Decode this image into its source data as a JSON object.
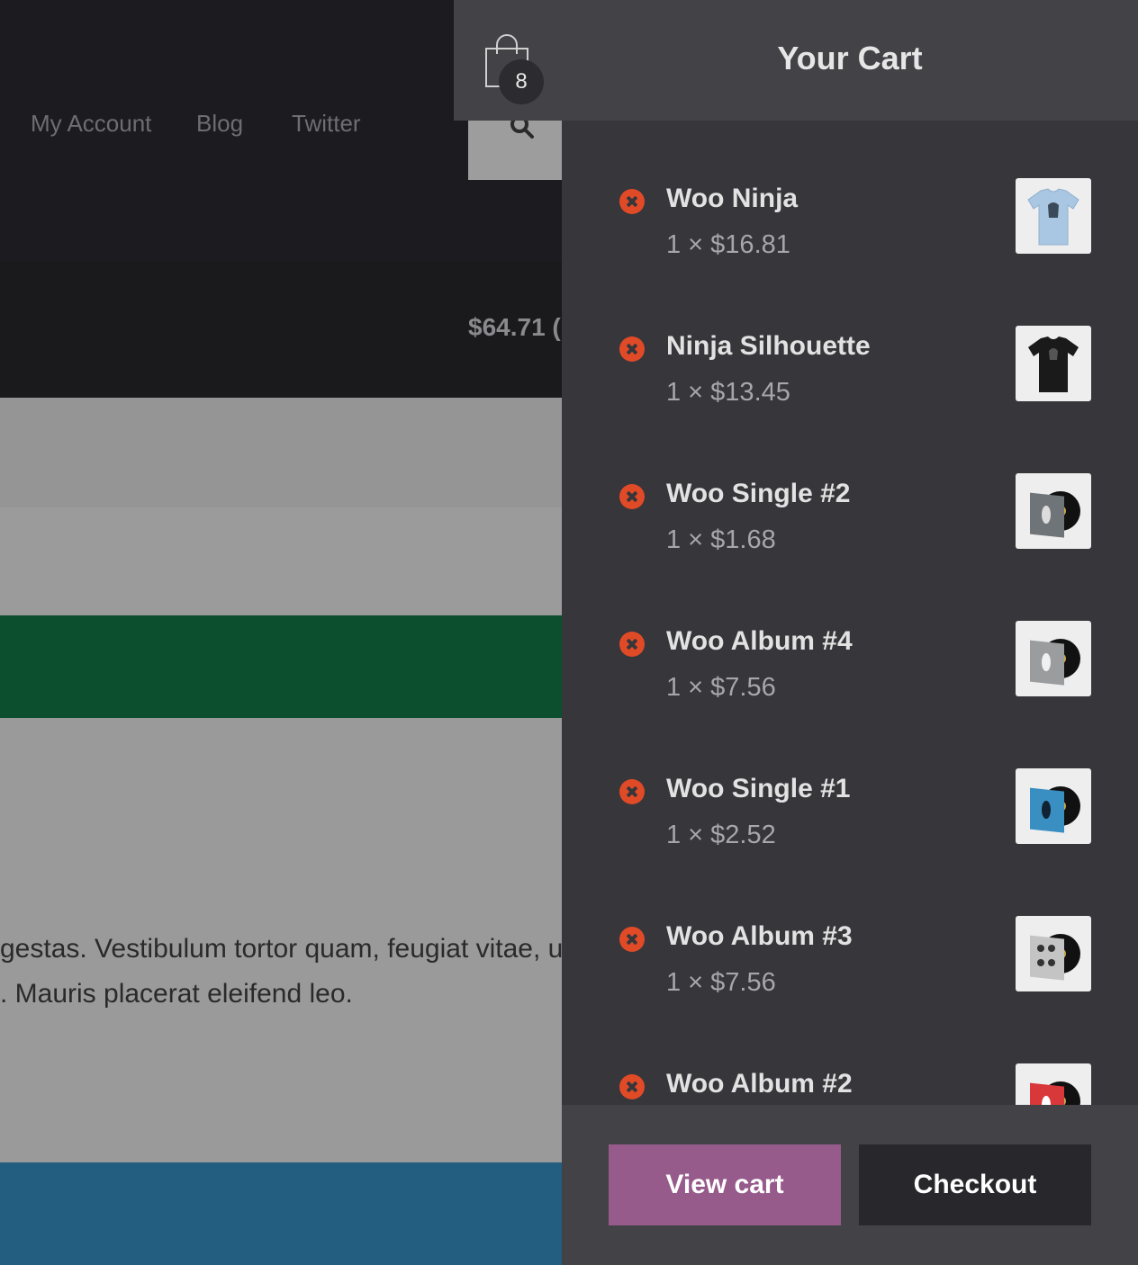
{
  "background_page": {
    "nav": [
      "My Account",
      "Blog",
      "Twitter"
    ],
    "cart_total_partial": "$64.71 (",
    "paragraph_lines": [
      "gestas. Vestibulum tortor quam, feugiat vitae, u",
      ". Mauris placerat eleifend leo."
    ]
  },
  "cart": {
    "title": "Your Cart",
    "count": "8",
    "items": [
      {
        "name": "Woo Ninja",
        "qty_price": "1 × $16.81",
        "thumb": "light-blue-tshirt"
      },
      {
        "name": "Ninja Silhouette",
        "qty_price": "1 × $13.45",
        "thumb": "black-tshirt"
      },
      {
        "name": "Woo Single #2",
        "qty_price": "1 × $1.68",
        "thumb": "vinyl-gray"
      },
      {
        "name": "Woo Album #4",
        "qty_price": "1 × $7.56",
        "thumb": "vinyl-silver"
      },
      {
        "name": "Woo Single #1",
        "qty_price": "1 × $2.52",
        "thumb": "vinyl-blue"
      },
      {
        "name": "Woo Album #3",
        "qty_price": "1 × $7.56",
        "thumb": "vinyl-light"
      },
      {
        "name": "Woo Album #2",
        "qty_price": "",
        "thumb": "vinyl-red"
      }
    ],
    "view_cart_label": "View cart",
    "checkout_label": "Checkout"
  },
  "colors": {
    "remove_icon": "#e14a27",
    "view_cart_button": "#965a8b",
    "checkout_button": "#28282c",
    "drawer_bg": "#36363b",
    "green_band": "#0c4f2e",
    "blue_band": "#235d80"
  }
}
